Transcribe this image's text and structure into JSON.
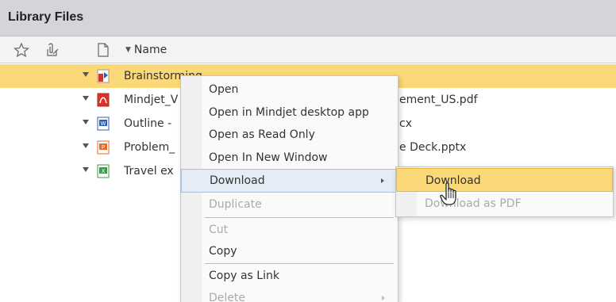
{
  "panel": {
    "title": "Library Files"
  },
  "columns": {
    "name_label": "Name"
  },
  "files": [
    {
      "name": "Brainstorming",
      "tail": "",
      "type": "mindmap",
      "selected": true
    },
    {
      "name": "Mindjet_V",
      "tail": "ement_US.pdf",
      "type": "pdf",
      "selected": false
    },
    {
      "name": "Outline - ",
      "tail": "cx",
      "type": "word",
      "selected": false
    },
    {
      "name": "Problem_",
      "tail": "e Deck.pptx",
      "type": "powerpoint",
      "selected": false
    },
    {
      "name": "Travel ex",
      "tail": "",
      "type": "excel",
      "selected": false
    }
  ],
  "context_menu": {
    "items": [
      {
        "label": "Open",
        "disabled": false
      },
      {
        "label": "Open in Mindjet desktop app",
        "disabled": false
      },
      {
        "label": "Open as Read Only",
        "disabled": false
      },
      {
        "label": "Open In New Window",
        "disabled": false
      },
      {
        "label": "Download",
        "disabled": false,
        "submenu": true,
        "hovered": true
      },
      {
        "label": "Duplicate",
        "disabled": true
      },
      {
        "label": "Cut",
        "disabled": true
      },
      {
        "label": "Copy",
        "disabled": false
      },
      {
        "label": "Copy as Link",
        "disabled": false
      },
      {
        "label": "Delete",
        "disabled": true,
        "submenu": true
      }
    ]
  },
  "download_submenu": {
    "items": [
      {
        "label": "Download",
        "disabled": false,
        "hovered": true
      },
      {
        "label": "Download as PDF",
        "disabled": true
      }
    ]
  },
  "colors": {
    "selected_row": "#fbd878",
    "title_bar": "#d3d5da",
    "menu_hover": "#e5ecf6",
    "pdf_red": "#d9322b",
    "word_blue": "#2f5fb3",
    "powerpoint_orange": "#e36b2c",
    "excel_green": "#3c9a4a"
  },
  "icons": {
    "header": [
      "star-icon",
      "attachment-icon",
      "document-icon"
    ],
    "cursor": "hand-pointer-icon"
  }
}
